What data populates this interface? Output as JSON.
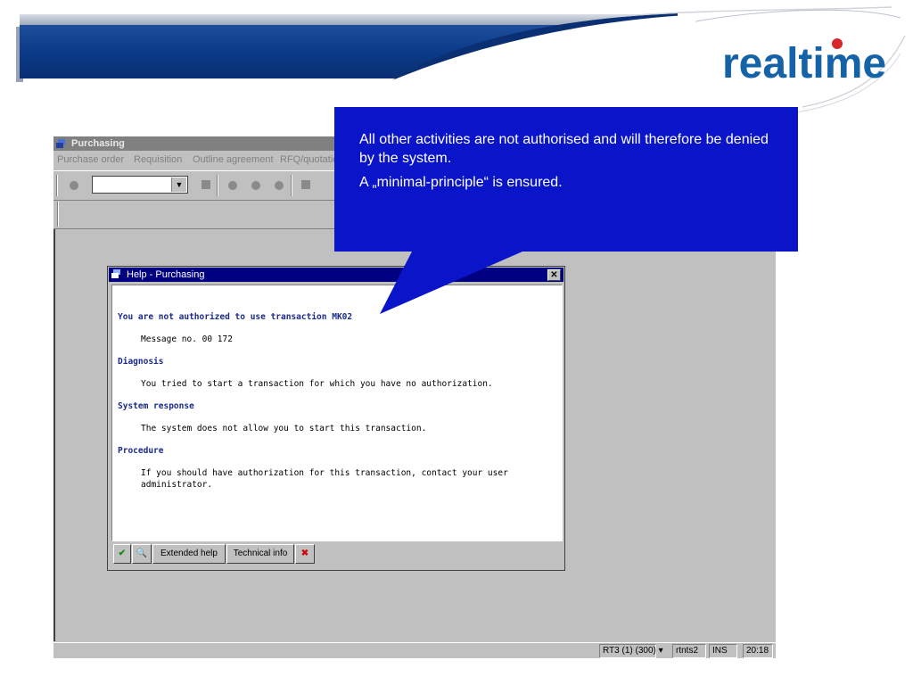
{
  "header": {
    "logo_text": "realtime"
  },
  "window": {
    "title": "Purchasing",
    "menu": [
      "Purchase order",
      "Requisition",
      "Outline agreement",
      "RFQ/quotation"
    ]
  },
  "dialog": {
    "title": "Help - Purchasing",
    "close_glyph": "✕",
    "lines": {
      "heading": "You are not authorized to use transaction MK02",
      "message_no": "Message no. 00 172",
      "diagnosis_h": "Diagnosis",
      "diagnosis": "You tried to start a transaction for which you have no authorization.",
      "sysresp_h": "System response",
      "sysresp": "The system does not allow you to start this transaction.",
      "procedure_h": "Procedure",
      "procedure_1": "If you should have authorization for this transaction, contact your user",
      "procedure_2": "administrator."
    },
    "buttons": {
      "ok_icon": "✔",
      "find_icon": "🔍",
      "extended_help": "Extended help",
      "technical_info": "Technical info",
      "cancel_icon": "✖"
    }
  },
  "callout": {
    "line1": "All other activities are not authorised and will therefore be denied by the system.",
    "line2": "A „minimal-principle“ is ensured."
  },
  "status": {
    "system": "RT3 (1) (300)",
    "server": "rtnts2",
    "mode": "INS",
    "time": "20:18"
  },
  "colors": {
    "callout_bg": "#0a14c8",
    "dialog_title_bg": "#000080",
    "sap_grey": "#c0c0c0",
    "header_blue": "#0b3a88",
    "logo_blue": "#1463a8"
  }
}
